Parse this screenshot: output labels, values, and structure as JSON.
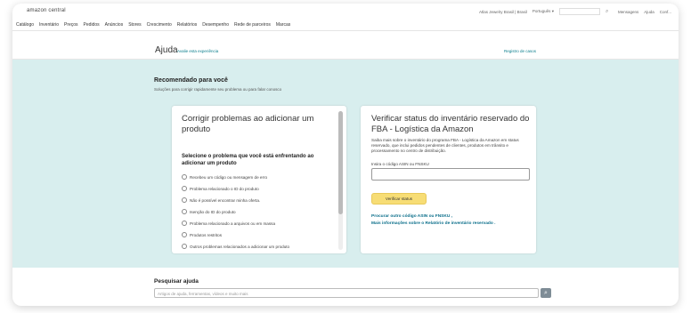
{
  "topbar": {
    "logo": "amazon central",
    "account": "Atlas Jewelry  Brasil | Brasil",
    "language": "Português",
    "messages": "Mensagens",
    "help": "Ajuda",
    "settings": "Conf..."
  },
  "nav": [
    "Catálogo",
    "Inventário",
    "Preços",
    "Pedidos",
    "Anúncios",
    "Stores",
    "Crescimento",
    "Relatórios",
    "Desempenho",
    "Rede de parceiros",
    "Marcas"
  ],
  "help_header": {
    "title": "Ajuda",
    "feedback": "Avalie esta experiência",
    "register": "Registro de casos"
  },
  "recommended": {
    "title": "Recomendado para você",
    "subtitle": "Soluções para corrigir rapidamente seu problema ou para falar conosco"
  },
  "left_card": {
    "title": "Corrigir problemas ao adicionar um produto",
    "subtitle": "Selecione o problema que você está enfrentando ao adicionar um produto",
    "options": [
      "Recebeu um código ou mensagem de erro",
      "Problema relacionado o ID do produto",
      "Não é possível encontrar minha oferta.",
      "Isenção do ID do produto",
      "Problema relacionado a arquivos ou em massa",
      "Produtos restritos",
      "Outros problemas relacionados a adicionar um produto"
    ]
  },
  "right_card": {
    "title": "Verificar status do inventário reservado do FBA - Logística da Amazon",
    "description": "Saiba mais sobre o inventário do programa FBA - Logística da Amazon em status reservado, que inclui pedidos pendentes de clientes, produtos em trânsito e processamento no centro de distribuição.",
    "input_label": "Insira o código ASIN ou FNSKU",
    "button": "Verificar status",
    "link1": "Procurar outro código ASIN ou FNSKU ,",
    "link2": "Mais informações sobre o Relatório de inventário reservado ."
  },
  "search": {
    "title": "Pesquisar ajuda",
    "placeholder": "Artigos de ajuda, ferramentas, vídeos e muito mais"
  }
}
